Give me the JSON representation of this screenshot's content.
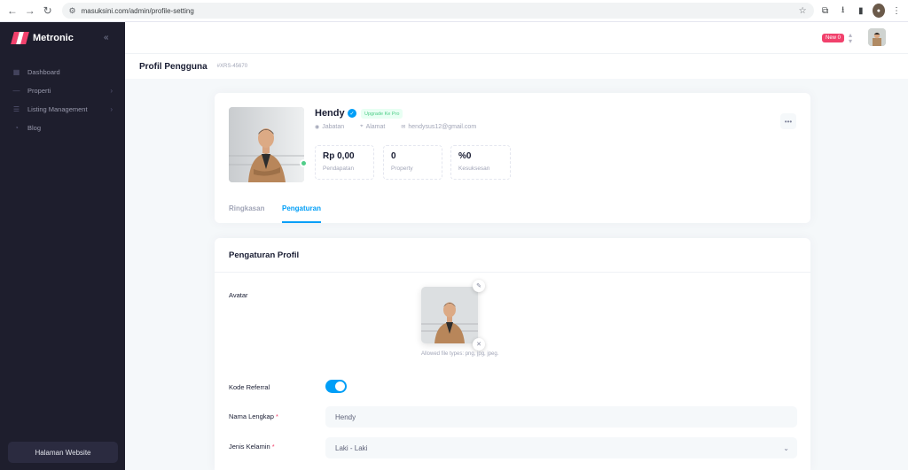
{
  "browser": {
    "url": "masuksini.com/admin/profile-setting"
  },
  "sidebar": {
    "brand": "Metronic",
    "items": [
      {
        "label": "Dashboard",
        "icon": "grid-icon",
        "has_children": false
      },
      {
        "label": "Properti",
        "icon": "minus-icon",
        "has_children": true
      },
      {
        "label": "Listing Management",
        "icon": "list-icon",
        "has_children": true
      },
      {
        "label": "Blog",
        "icon": "circle-icon",
        "has_children": false
      }
    ],
    "footer_button": "Halaman Website"
  },
  "header": {
    "new_badge": "New 0"
  },
  "toolbar": {
    "title": "Profil Pengguna",
    "subtitle": "#XRS-45670"
  },
  "profile": {
    "name": "Hendy",
    "badge": "Upgrade Ke Pro",
    "meta": {
      "jabatan": "Jabatan",
      "alamat": "Alamat",
      "email": "hendysus12@gmail.com"
    },
    "stats": [
      {
        "value": "Rp 0,00",
        "label": "Pendapatan"
      },
      {
        "value": "0",
        "label": "Property"
      },
      {
        "value": "%0",
        "label": "Kesuksesan"
      }
    ],
    "tabs": [
      {
        "label": "Ringkasan",
        "active": false
      },
      {
        "label": "Pengaturan",
        "active": true
      }
    ]
  },
  "settings": {
    "title": "Pengaturan Profil",
    "avatar_label": "Avatar",
    "avatar_hint": "Allowed file types: png, jpg, jpeg.",
    "referral_label": "Kode Referral",
    "referral_enabled": true,
    "fullname_label": "Nama Lengkap",
    "fullname_value": "Hendy",
    "gender_label": "Jenis Kelamin",
    "gender_value": "Laki - Laki",
    "required_mark": "*"
  },
  "colors": {
    "primary": "#009ef7",
    "sidebar_bg": "#1e1e2d",
    "danger": "#f1416c",
    "success": "#50cd89"
  }
}
